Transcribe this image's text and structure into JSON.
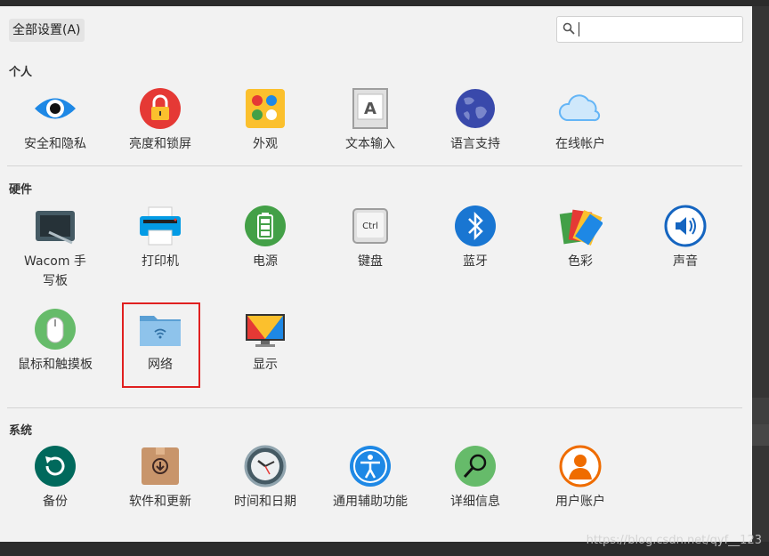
{
  "toolbar": {
    "all_settings_label": "全部设置(A)"
  },
  "search": {
    "placeholder": ""
  },
  "sections": {
    "personal": {
      "title": "个人",
      "items": [
        {
          "label": "安全和隐私",
          "icon": "eye-icon"
        },
        {
          "label": "亮度和锁屏",
          "icon": "padlock-icon"
        },
        {
          "label": "外观",
          "icon": "palette-dots-icon"
        },
        {
          "label": "文本输入",
          "icon": "text-input-icon"
        },
        {
          "label": "语言支持",
          "icon": "globe-icon"
        },
        {
          "label": "在线帐户",
          "icon": "cloud-icon"
        }
      ]
    },
    "hardware": {
      "title": "硬件",
      "items": [
        {
          "label": "Wacom 手写板",
          "icon": "tablet-pen-icon"
        },
        {
          "label": "打印机",
          "icon": "printer-icon"
        },
        {
          "label": "电源",
          "icon": "battery-icon"
        },
        {
          "label": "键盘",
          "icon": "keyboard-ctrl-icon"
        },
        {
          "label": "蓝牙",
          "icon": "bluetooth-icon"
        },
        {
          "label": "色彩",
          "icon": "color-cards-icon"
        },
        {
          "label": "声音",
          "icon": "speaker-icon"
        },
        {
          "label": "鼠标和触摸板",
          "icon": "mouse-icon"
        },
        {
          "label": "网络",
          "icon": "network-folder-icon"
        },
        {
          "label": "显示",
          "icon": "monitor-icon"
        }
      ]
    },
    "system": {
      "title": "系统",
      "items": [
        {
          "label": "备份",
          "icon": "backup-icon"
        },
        {
          "label": "软件和更新",
          "icon": "software-update-icon"
        },
        {
          "label": "时间和日期",
          "icon": "clock-icon"
        },
        {
          "label": "通用辅助功能",
          "icon": "accessibility-icon"
        },
        {
          "label": "详细信息",
          "icon": "details-magnifier-icon"
        },
        {
          "label": "用户账户",
          "icon": "user-account-icon"
        }
      ]
    }
  },
  "watermark": "https://blog.csdn.net/qyf__123",
  "colors": {
    "window_bg": "#f2f2f2",
    "highlight": "#e02020"
  }
}
